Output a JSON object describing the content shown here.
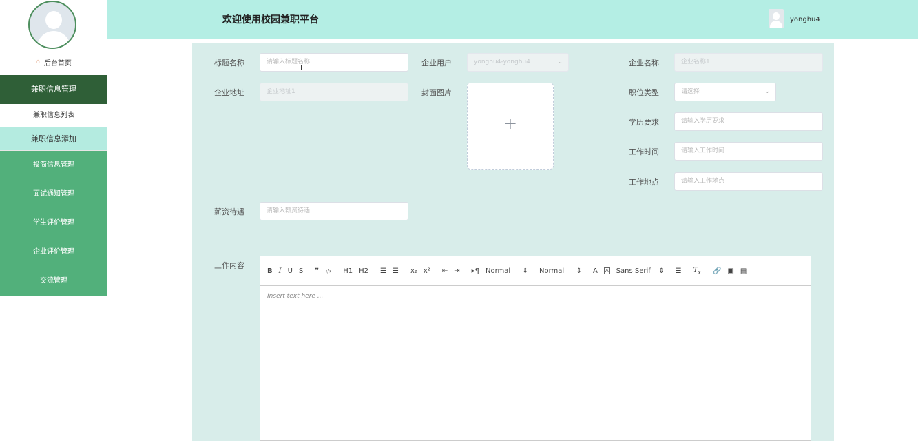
{
  "header": {
    "title": "欢迎使用校园兼职平台",
    "username": "yonghu4"
  },
  "sidebar": {
    "home": "后台首页",
    "group_active": "兼职信息管理",
    "sub_items": [
      "兼职信息列表",
      "兼职信息添加"
    ],
    "items": [
      "投简信息管理",
      "面试通知管理",
      "学生评价管理",
      "企业评价管理",
      "交流管理"
    ]
  },
  "form": {
    "title_label": "标题名称",
    "title_placeholder": "请输入标题名称",
    "company_user_label": "企业用户",
    "company_user_value": "yonghu4-yonghu4",
    "company_name_label": "企业名称",
    "company_name_value": "企业名称1",
    "company_address_label": "企业地址",
    "company_address_value": "企业地址1",
    "cover_label": "封面图片",
    "cover_plus": "+",
    "position_type_label": "职位类型",
    "position_type_placeholder": "请选择",
    "education_label": "学历要求",
    "education_placeholder": "请输入学历要求",
    "work_time_label": "工作时间",
    "work_time_placeholder": "请输入工作时间",
    "work_place_label": "工作地点",
    "work_place_placeholder": "请输入工作地点",
    "salary_label": "薪资待遇",
    "salary_placeholder": "请输入薪资待遇",
    "content_label": "工作内容"
  },
  "editor": {
    "buttons": [
      "B",
      "I",
      "U",
      "S",
      "❞",
      "‹/›",
      "H1",
      "H2",
      "☰",
      "☰",
      "x₂",
      "x²",
      "⇤",
      "⇥",
      "▸¶"
    ],
    "header_select": "Normal",
    "size_select": "Normal",
    "font_select": "Sans Serif",
    "placeholder": "Insert text here ..."
  }
}
